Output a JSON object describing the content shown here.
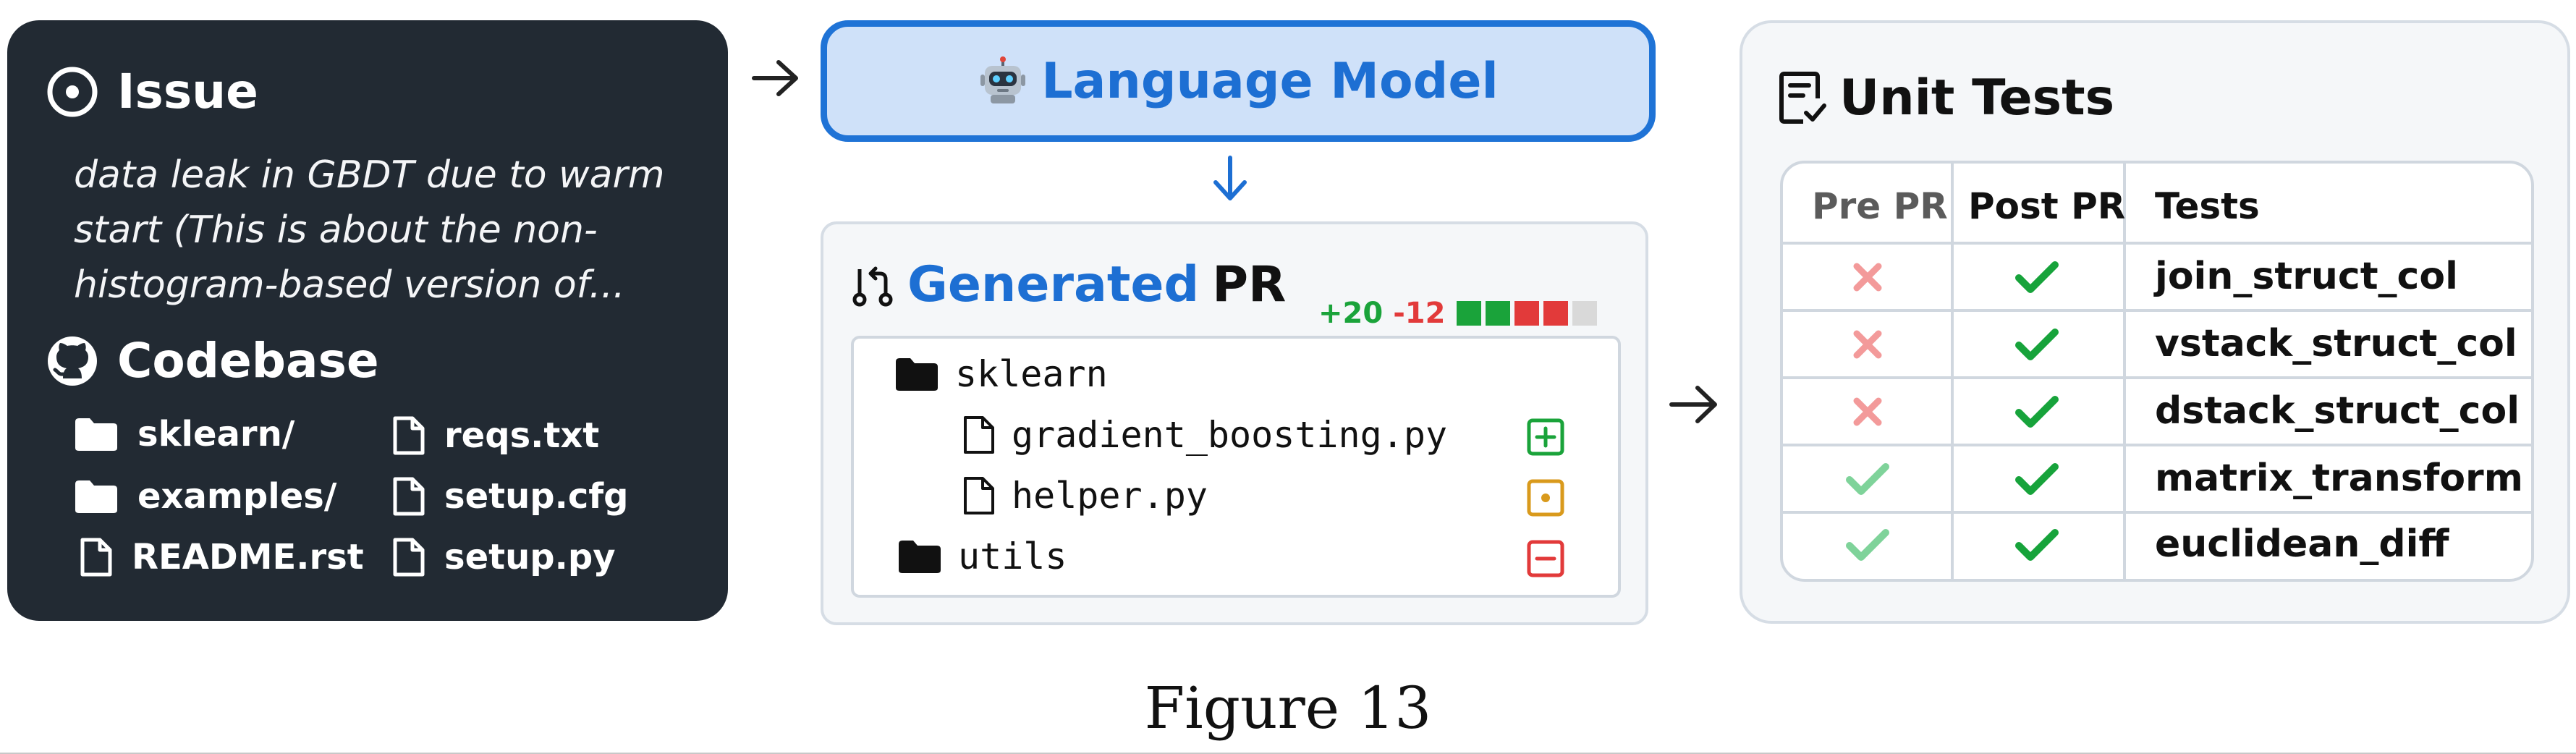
{
  "issue": {
    "heading": "Issue",
    "icon": "issue-opened-icon",
    "text": "data leak in GBDT due to warm start (This is about the non-histogram-based version of..."
  },
  "codebase": {
    "heading": "Codebase",
    "icon": "github-icon",
    "items": [
      {
        "label": "sklearn/",
        "kind": "folder"
      },
      {
        "label": "examples/",
        "kind": "folder"
      },
      {
        "label": "README.rst",
        "kind": "file"
      },
      {
        "label": "reqs.txt",
        "kind": "file"
      },
      {
        "label": "setup.cfg",
        "kind": "file"
      },
      {
        "label": "setup.py",
        "kind": "file"
      }
    ]
  },
  "language_model": {
    "icon": "robot-icon",
    "title": "Language Model"
  },
  "pr": {
    "icon": "pull-request-icon",
    "title_accent": "Generated",
    "title_rest": "PR",
    "additions": "+20",
    "deletions": "-12",
    "diff_blocks": [
      "added",
      "added",
      "removed",
      "removed",
      "neutral"
    ],
    "tree": [
      {
        "label": "sklearn",
        "kind": "folder",
        "depth": 0,
        "status": null
      },
      {
        "label": "gradient_boosting.py",
        "kind": "file",
        "depth": 1,
        "status": "added"
      },
      {
        "label": "helper.py",
        "kind": "file",
        "depth": 1,
        "status": "modified"
      },
      {
        "label": "utils",
        "kind": "folder",
        "depth": 0,
        "status": "removed"
      }
    ]
  },
  "unit_tests": {
    "heading": "Unit Tests",
    "icon": "checklist-icon",
    "columns": [
      "Pre PR",
      "Post PR",
      "Tests"
    ],
    "rows": [
      {
        "pre": "fail",
        "post": "pass",
        "name": "join_struct_col"
      },
      {
        "pre": "fail",
        "post": "pass",
        "name": "vstack_struct_col"
      },
      {
        "pre": "fail",
        "post": "pass",
        "name": "dstack_struct_col"
      },
      {
        "pre": "pass",
        "post": "pass",
        "name": "matrix_transform"
      },
      {
        "pre": "pass",
        "post": "pass",
        "name": "euclidean_diff"
      }
    ]
  },
  "caption": "Figure 13",
  "colors": {
    "panel_dark": "#222a33",
    "accent_blue": "#1d6fd3",
    "lm_fill": "#cfe1f9",
    "add_green": "#1aa33a",
    "del_red": "#e23a3a",
    "modified_orange": "#d99a1c",
    "pass_green": "#17a33b",
    "pass_light": "#7fd39a",
    "fail_light": "#f39a9a",
    "neutral_grey": "#d9d9d9"
  }
}
